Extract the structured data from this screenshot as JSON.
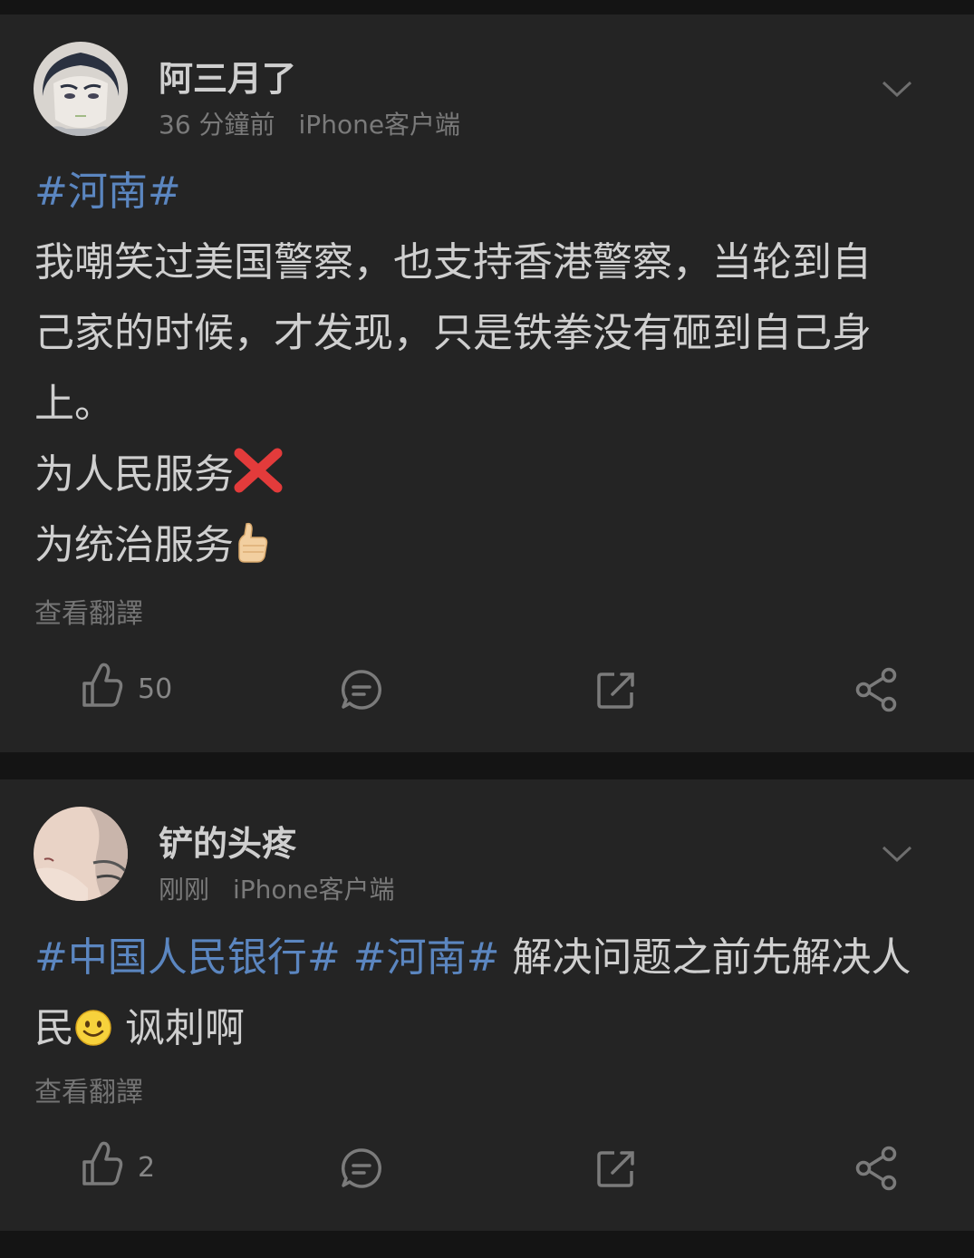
{
  "posts": [
    {
      "username": "阿三月了",
      "time": "36 分鐘前",
      "source": "iPhone客户端",
      "hashtag1": "#河南#",
      "line1": "我嘲笑过美国警察，也支持香港警察，当轮到自",
      "line2": "己家的时候，才发现，只是铁拳没有砸到自己身",
      "line3": "上。",
      "line4": "为人民服务",
      "line5": "为统治服务",
      "translate": "查看翻譯",
      "like_count": "50",
      "emoji_cross": "cross-mark-emoji",
      "emoji_thumb": "thumbs-up-emoji"
    },
    {
      "username": "铲的头疼",
      "time": "刚刚",
      "source": "iPhone客户端",
      "hashtag1": "#中国人民银行#",
      "hashtag2": "#河南#",
      "text1": " 解决问题之前先解决人",
      "text2a": "民",
      "text2b": " 讽刺啊",
      "translate": "查看翻譯",
      "like_count": "2",
      "emoji_smile": "smiling-face-emoji"
    }
  ],
  "colors": {
    "background": "#141414",
    "card": "#242424",
    "hashtag": "#5b86c0",
    "text": "#cfcfcf",
    "meta": "#7a7a7a"
  }
}
